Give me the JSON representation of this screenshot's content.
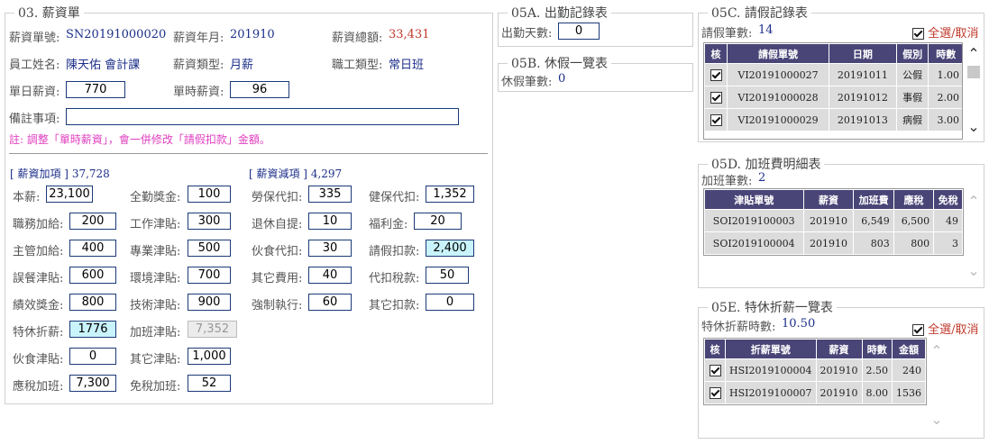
{
  "salary": {
    "legend": "03. 薪資單",
    "no_label": "薪資單號:",
    "no_value": "SN20191000020",
    "ym_label": "薪資年月:",
    "ym_value": "201910",
    "total_label": "薪資總額:",
    "total_value": "33,431",
    "emp_label": "員工姓名:",
    "emp_value": "陳天佑 會計課",
    "type_label": "薪資類型:",
    "type_value": "月薪",
    "job_label": "職工類型:",
    "job_value": "常日班",
    "daily_label": "單日薪資:",
    "daily_value": "770",
    "hourly_label": "單時薪資:",
    "hourly_value": "96",
    "note_label": "備註事項:",
    "note_value": "",
    "hint": "註: 調整「單時薪資」，會一併修改「請假扣款」金額。",
    "add_label": "[ 薪資加項 ]",
    "add_total": "37,728",
    "sub_label": "[ 薪資減項 ]",
    "sub_total": "4,297",
    "add_items": [
      {
        "label": "本薪:",
        "value": "23,100"
      },
      {
        "label": "全勤獎金:",
        "value": "100"
      },
      {
        "label": "職務加給:",
        "value": "200"
      },
      {
        "label": "工作津貼:",
        "value": "300"
      },
      {
        "label": "主管加給:",
        "value": "400"
      },
      {
        "label": "專業津貼:",
        "value": "500"
      },
      {
        "label": "誤餐津貼:",
        "value": "600"
      },
      {
        "label": "環境津貼:",
        "value": "700"
      },
      {
        "label": "績效獎金:",
        "value": "800"
      },
      {
        "label": "技術津貼:",
        "value": "900"
      },
      {
        "label": "特休折薪:",
        "value": "1776"
      },
      {
        "label": "加班津貼:",
        "value": "7,352"
      },
      {
        "label": "伙食津貼:",
        "value": "0"
      },
      {
        "label": "其它津貼:",
        "value": "1,000"
      },
      {
        "label": "應稅加班:",
        "value": "7,300"
      },
      {
        "label": "免稅加班:",
        "value": "52"
      }
    ],
    "sub_items": [
      {
        "label": "勞保代扣:",
        "value": "335"
      },
      {
        "label": "健保代扣:",
        "value": "1,352"
      },
      {
        "label": "退休自提:",
        "value": "10"
      },
      {
        "label": "福利金:",
        "value": "20"
      },
      {
        "label": "伙食代扣:",
        "value": "30"
      },
      {
        "label": "請假扣款:",
        "value": "2,400"
      },
      {
        "label": "其它費用:",
        "value": "40"
      },
      {
        "label": "代扣稅款:",
        "value": "50"
      },
      {
        "label": "強制執行:",
        "value": "60"
      },
      {
        "label": "其它扣款:",
        "value": "0"
      }
    ]
  },
  "attendance": {
    "legend": "05A. 出勤記錄表",
    "days_label": "出勤天數:",
    "days_value": "0"
  },
  "holiday": {
    "legend": "05B. 休假一覽表",
    "count_label": "休假筆數:",
    "count_value": "0"
  },
  "leave": {
    "legend": "05C. 請假記錄表",
    "count_label": "請假筆數:",
    "count_value": "14",
    "select_all": "全選/取消",
    "headers": [
      "核",
      "請假單號",
      "日期",
      "假別",
      "時數"
    ],
    "rows": [
      {
        "no": "VI20191000027",
        "date": "20191011",
        "type": "公假",
        "hours": "1.00"
      },
      {
        "no": "VI20191000028",
        "date": "20191012",
        "type": "事假",
        "hours": "2.00"
      },
      {
        "no": "VI20191000029",
        "date": "20191013",
        "type": "病假",
        "hours": "3.00"
      }
    ]
  },
  "overtime": {
    "legend": "05D. 加班費明細表",
    "count_label": "加班筆數:",
    "count_value": "2",
    "headers": [
      "津貼單號",
      "薪資",
      "加班費",
      "應稅",
      "免稅"
    ],
    "rows": [
      {
        "no": "SOI2019100003",
        "ym": "201910",
        "fee": "6,549",
        "tax": "6,500",
        "free": "49"
      },
      {
        "no": "SOI2019100004",
        "ym": "201910",
        "fee": "803",
        "tax": "800",
        "free": "3"
      }
    ]
  },
  "annual": {
    "legend": "05E. 特休折薪一覽表",
    "hours_label": "特休折薪時數:",
    "hours_value": "10.50",
    "select_all": "全選/取消",
    "headers": [
      "核",
      "折薪單號",
      "薪資",
      "時數",
      "金額"
    ],
    "rows": [
      {
        "no": "HSI2019100004",
        "ym": "201910",
        "hours": "2.50",
        "amount": "240"
      },
      {
        "no": "HSI2019100007",
        "ym": "201910",
        "hours": "8.00",
        "amount": "1536"
      }
    ]
  }
}
